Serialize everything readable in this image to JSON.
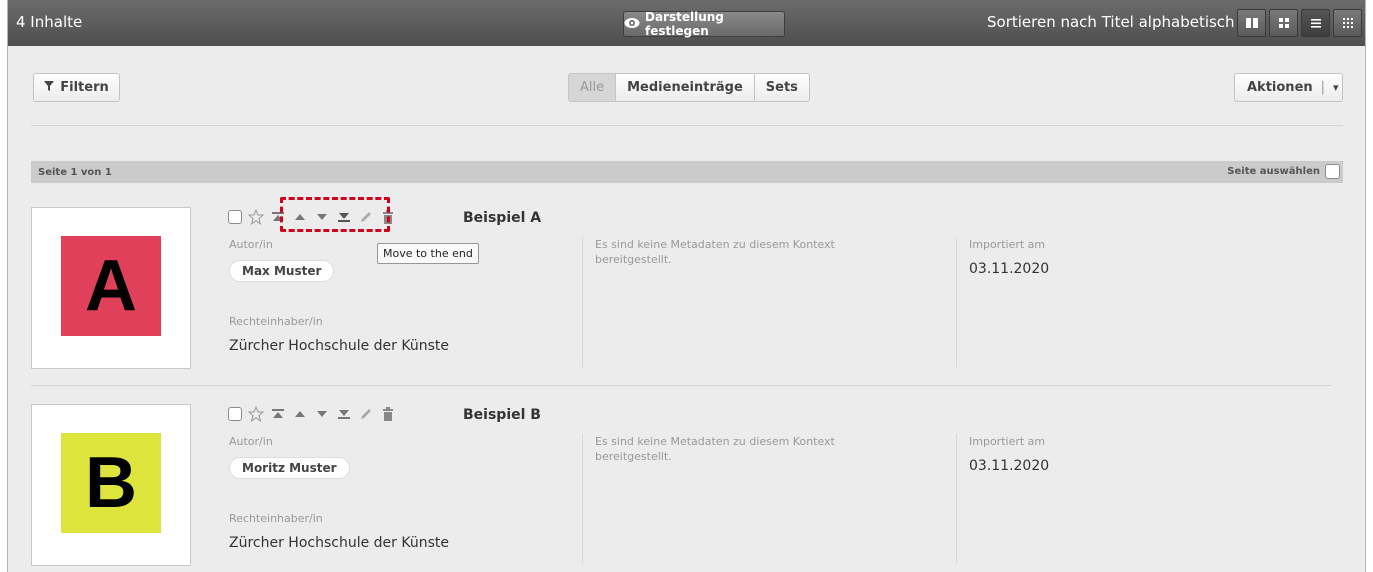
{
  "header": {
    "count_label": "4 Inhalte",
    "display_button": "Darstellung festlegen",
    "sort_label": "Sortieren nach Titel alphabetisch ▾",
    "views": [
      "Spalten",
      "Raster",
      "Liste",
      "Kacheln"
    ],
    "active_view": "Liste"
  },
  "toolbar": {
    "filter_label": "Filtern",
    "segments": [
      "Alle",
      "Medieneinträge",
      "Sets"
    ],
    "active_segment": "Alle",
    "actions_label": "Aktionen",
    "actions_sep": "|",
    "actions_caret": "▾"
  },
  "pagebar": {
    "page_label": "Seite 1 von 1",
    "select_label": "Seite auswählen"
  },
  "entries": [
    {
      "title": "Beispiel A",
      "letter": "A",
      "color": "#e0405a",
      "author_label": "Autor/in",
      "author": "Max Muster",
      "rights_label": "Rechteinhaber/in",
      "rights": "Zürcher Hochschule der Künste",
      "no_metadata": "Es sind keine Metadaten zu diesem Kontext bereitgestellt.",
      "imported_label": "Importiert am",
      "imported_date": "03.11.2020"
    },
    {
      "title": "Beispiel B",
      "letter": "B",
      "color": "#dde43c",
      "author_label": "Autor/in",
      "author": "Moritz Muster",
      "rights_label": "Rechteinhaber/in",
      "rights": "Zürcher Hochschule der Künste",
      "no_metadata": "Es sind keine Metadaten zu diesem Kontext bereitgestellt.",
      "imported_label": "Importiert am",
      "imported_date": "03.11.2020"
    }
  ],
  "tooltip": "Move to the end",
  "icons": [
    "checkbox",
    "star-icon",
    "move-to-top-icon",
    "move-up-icon",
    "move-down-icon",
    "move-to-end-icon",
    "edit-icon",
    "trash-icon"
  ]
}
